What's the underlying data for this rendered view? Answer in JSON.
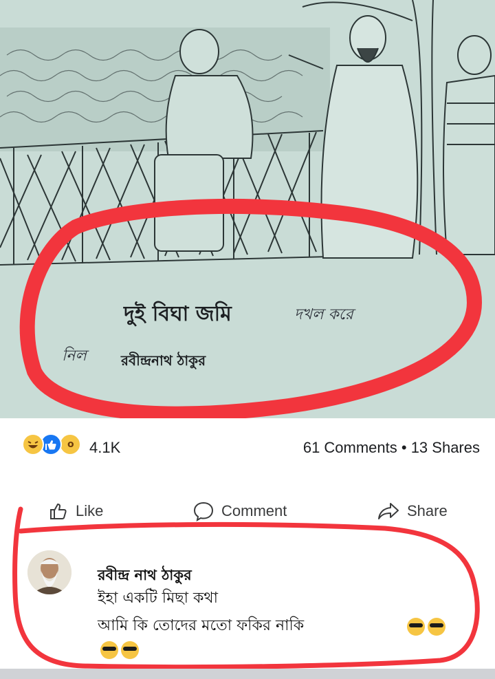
{
  "post": {
    "caption_printed": "দুই বিঘা জমি",
    "caption_handwritten": "দখল করে",
    "handwritten_prefix": "নিল",
    "caption_author": "রবীন্দ্রনাথ ঠাকুর"
  },
  "stats": {
    "reactions_count": "4.1K",
    "comments_shares": "61 Comments • 13 Shares"
  },
  "actions": {
    "like": "Like",
    "comment": "Comment",
    "share": "Share"
  },
  "comment": {
    "author": "রবীন্দ্র নাথ ঠাকুর",
    "line1": "ইহা একটি মিছা কথা",
    "line2": "আমি কি তোদের মতো ফকির নাকি"
  },
  "colors": {
    "highlight_circle": "#f2353d",
    "like_blue": "#1877f2",
    "emoji_yellow": "#f6c543",
    "illustration_bg": "#c9dcd6"
  },
  "icons": [
    "haha-emoji-icon",
    "like-emoji-icon",
    "wow-emoji-icon",
    "thumbs-up-icon",
    "speech-bubble-icon",
    "share-arrow-icon",
    "sunglasses-emoji-icon"
  ]
}
